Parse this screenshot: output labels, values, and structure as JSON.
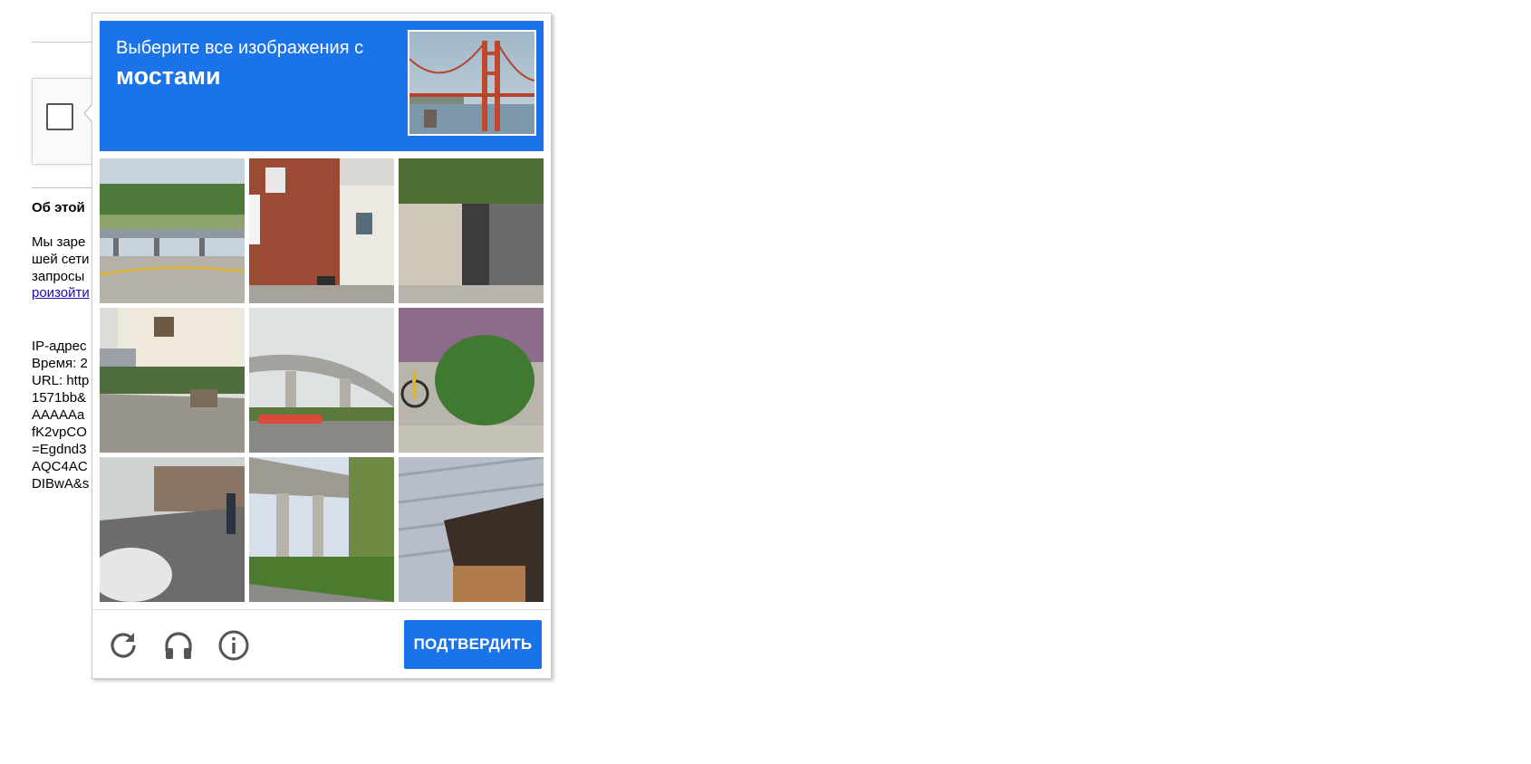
{
  "background_page": {
    "about_title": "Об этой",
    "about_text_lines": [
      "Мы заре",
      "шей сети",
      "запросы"
    ],
    "about_link": "роизойти",
    "info_lines": [
      "IP-адрес",
      "Время: 2",
      "URL: http",
      "1571bb&",
      "AAAAAa",
      "fK2vpCO",
      "=Egdnd3",
      "AQC4AC",
      "DIBwA&s"
    ]
  },
  "challenge": {
    "instruction": "Выберите все изображения с",
    "target_object": "мостами",
    "sample_image": "golden-gate-bridge",
    "tiles": [
      {
        "subject": "river-bridge-road"
      },
      {
        "subject": "brick-building-street"
      },
      {
        "subject": "hedge-gate-wall"
      },
      {
        "subject": "house-front-garden"
      },
      {
        "subject": "curved-overpass"
      },
      {
        "subject": "green-bush-bicycle"
      },
      {
        "subject": "street-wall-car"
      },
      {
        "subject": "bridge-underside"
      },
      {
        "subject": "metal-shed-wall"
      }
    ],
    "footer": {
      "reload_icon": "reload-icon",
      "audio_icon": "headphones-icon",
      "info_icon": "info-icon",
      "verify_label": "ПОДТВЕРДИТЬ"
    }
  },
  "colors": {
    "accent": "#1a73e8",
    "link": "#1a0dab",
    "icon_gray": "#555555"
  }
}
